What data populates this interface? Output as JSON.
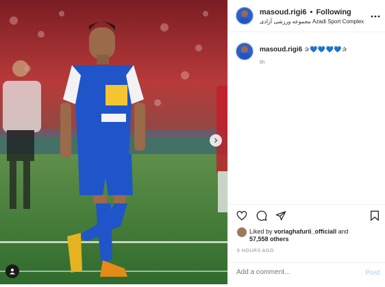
{
  "post": {
    "author": {
      "username": "masoud.rigi6",
      "separator": "•",
      "follow_status": "Following",
      "location": "مجموعه ورزشی آزادی Azadi Sport Complex"
    },
    "more_icon": "more-horizontal-icon",
    "caption": {
      "username": "masoud.rigi6",
      "text": "✰💙💙💙💙✰",
      "time": "6h"
    },
    "actions": {
      "icons": [
        "heart-icon",
        "comment-icon",
        "share-icon",
        "bookmark-icon"
      ]
    },
    "likes": {
      "prefix": "Liked by",
      "user": "voriaghafurii_officiall",
      "and": "and",
      "others": "57,558 others"
    },
    "posted_ago": "6 HOURS AGO",
    "comment": {
      "placeholder": "Add a comment...",
      "post_label": "Post"
    },
    "colors": {
      "jersey": "#1f55c9",
      "pitch": "#3d7a3a",
      "post_button": "#b2dffc"
    }
  }
}
